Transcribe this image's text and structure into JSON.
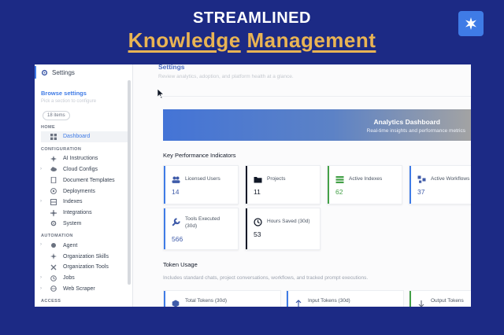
{
  "hero": {
    "line1": "STREAMLINED",
    "word1": "Knowledge",
    "word2": "Management"
  },
  "sidebar": {
    "header": "Settings",
    "browse_title": "Browse settings",
    "browse_subtitle": "Pick a section to configure",
    "items_count": "18 items",
    "sections": {
      "home": "HOME",
      "configuration": "CONFIGURATION",
      "automation": "AUTOMATION",
      "access": "ACCESS"
    },
    "home_items": [
      {
        "label": "Dashboard",
        "icon": "dashboard-icon"
      }
    ],
    "configuration_items": [
      {
        "label": "AI Instructions",
        "icon": "sparkle-icon"
      },
      {
        "label": "Cloud Configs",
        "icon": "cloud-icon"
      },
      {
        "label": "Document Templates",
        "icon": "document-icon"
      },
      {
        "label": "Deployments",
        "icon": "deploy-icon"
      },
      {
        "label": "Indexes",
        "icon": "indexes-icon"
      },
      {
        "label": "Integrations",
        "icon": "integrations-icon"
      },
      {
        "label": "System",
        "icon": "gear-icon"
      }
    ],
    "automation_items": [
      {
        "label": "Agent",
        "icon": "agent-icon"
      },
      {
        "label": "Organization Skills",
        "icon": "skills-icon"
      },
      {
        "label": "Organization Tools",
        "icon": "tools-icon"
      },
      {
        "label": "Jobs",
        "icon": "clock-icon"
      },
      {
        "label": "Web Scraper",
        "icon": "globe-icon"
      }
    ]
  },
  "content": {
    "title": "Settings",
    "subtitle": "Review analytics, adoption, and platform health at a glance.",
    "banner": {
      "title": "Analytics Dashboard",
      "subtitle": "Real-time insights and performance metrics"
    },
    "kpi_title": "Key Performance Indicators",
    "kpis": [
      {
        "label": "Licensed Users",
        "value": "14",
        "icon": "users-icon",
        "color": "#3f7be6"
      },
      {
        "label": "Projects",
        "value": "11",
        "icon": "folder-icon",
        "color": "#111827"
      },
      {
        "label": "Active Indexes",
        "value": "62",
        "icon": "list-icon",
        "color": "#43a047"
      },
      {
        "label": "Active Workflows",
        "value": "37",
        "icon": "workflow-icon",
        "color": "#3f7be6"
      },
      {
        "label": "Tools Executed (30d)",
        "value": "566",
        "icon": "wrench-icon",
        "color": "#3f7be6"
      },
      {
        "label": "Hours Saved (30d)",
        "value": "53",
        "icon": "clock-icon",
        "color": "#111827"
      }
    ],
    "token_title": "Token Usage",
    "token_subtitle": "Includes standard chats, project conversations, workflows, and tracked prompt executions.",
    "token_cards": [
      {
        "label": "Total Tokens (30d)",
        "icon": "cube-icon",
        "color": "#3f7be6"
      },
      {
        "label": "Input Tokens (30d)",
        "icon": "arrow-up-icon",
        "color": "#3f7be6"
      },
      {
        "label": "Output Tokens",
        "icon": "arrow-down-icon",
        "color": "#43a047"
      }
    ]
  }
}
